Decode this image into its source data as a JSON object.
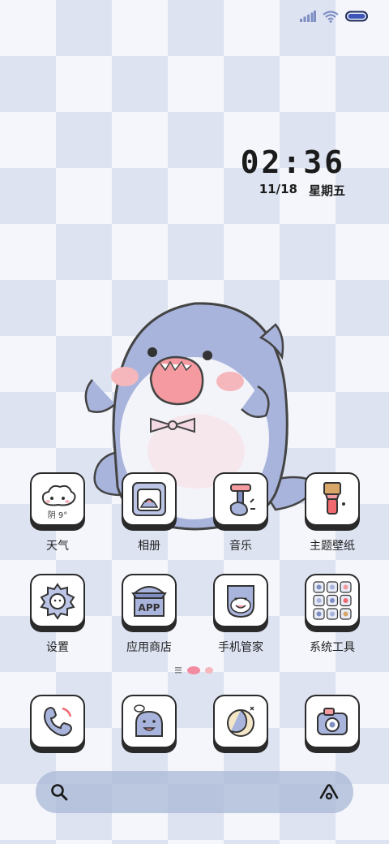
{
  "status_bar": {
    "signal_icon": "signal-icon",
    "wifi_icon": "wifi-icon",
    "battery_icon": "battery-icon"
  },
  "clock": {
    "time": "02:36",
    "date": "11/18",
    "weekday": "星期五"
  },
  "wallpaper": {
    "character_icon": "shark-mascot-icon"
  },
  "apps_row1": [
    {
      "label": "天气",
      "icon": "weather-cloud-icon",
      "widget_text": "阴 9°"
    },
    {
      "label": "相册",
      "icon": "gallery-icon"
    },
    {
      "label": "音乐",
      "icon": "music-icon"
    },
    {
      "label": "主题壁纸",
      "icon": "theme-brush-icon"
    }
  ],
  "apps_row2": [
    {
      "label": "设置",
      "icon": "settings-gear-icon"
    },
    {
      "label": "应用商店",
      "icon": "app-store-icon",
      "icon_text": "APP"
    },
    {
      "label": "手机管家",
      "icon": "phone-manager-icon"
    },
    {
      "label": "系统工具",
      "icon": "system-tools-icon"
    }
  ],
  "dock": [
    {
      "icon": "phone-icon"
    },
    {
      "icon": "messages-icon"
    },
    {
      "icon": "browser-icon"
    },
    {
      "icon": "camera-icon"
    }
  ],
  "search": {
    "search_icon": "search-icon",
    "assistant_icon": "assistant-icon"
  },
  "colors": {
    "checker": "#dde3f1",
    "shark_body": "#a9b4dc",
    "blush": "#f6b7bc",
    "outline": "#2a2a2a"
  }
}
